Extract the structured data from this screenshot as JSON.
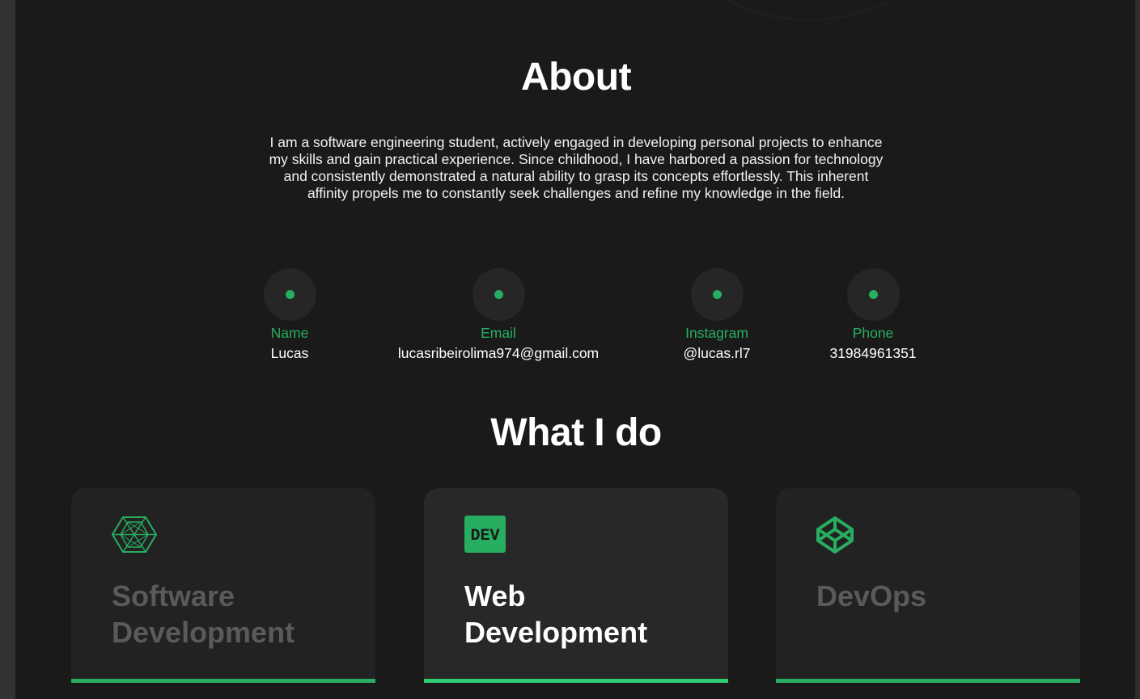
{
  "about": {
    "title": "About",
    "text": "I am a software engineering student, actively engaged in developing personal projects to enhance my skills and gain practical experience. Since childhood, I have harbored a passion for technology and consistently demonstrated a natural ability to grasp its concepts effortlessly. This inherent affinity propels me to constantly seek challenges and refine my knowledge in the field."
  },
  "contacts": [
    {
      "label": "Name",
      "value": "Lucas"
    },
    {
      "label": "Email",
      "value": "lucasribeirolima974@gmail.com"
    },
    {
      "label": "Instagram",
      "value": "@lucas.rl7"
    },
    {
      "label": "Phone",
      "value": "31984961351"
    }
  ],
  "what_i_do": {
    "title": "What I do",
    "cards": [
      {
        "title": "Software Development",
        "icon": "hexagon-mesh-icon",
        "active": false
      },
      {
        "title": "Web Development",
        "icon": "dev-badge-icon",
        "icon_text": "DEV",
        "active": true
      },
      {
        "title": "DevOps",
        "icon": "codepen-cube-icon",
        "active": false
      }
    ]
  },
  "colors": {
    "background": "#1a1a1a",
    "accent": "#27ae60",
    "card": "#222222",
    "card_active": "#282828",
    "muted_title": "#5a5a5a"
  }
}
